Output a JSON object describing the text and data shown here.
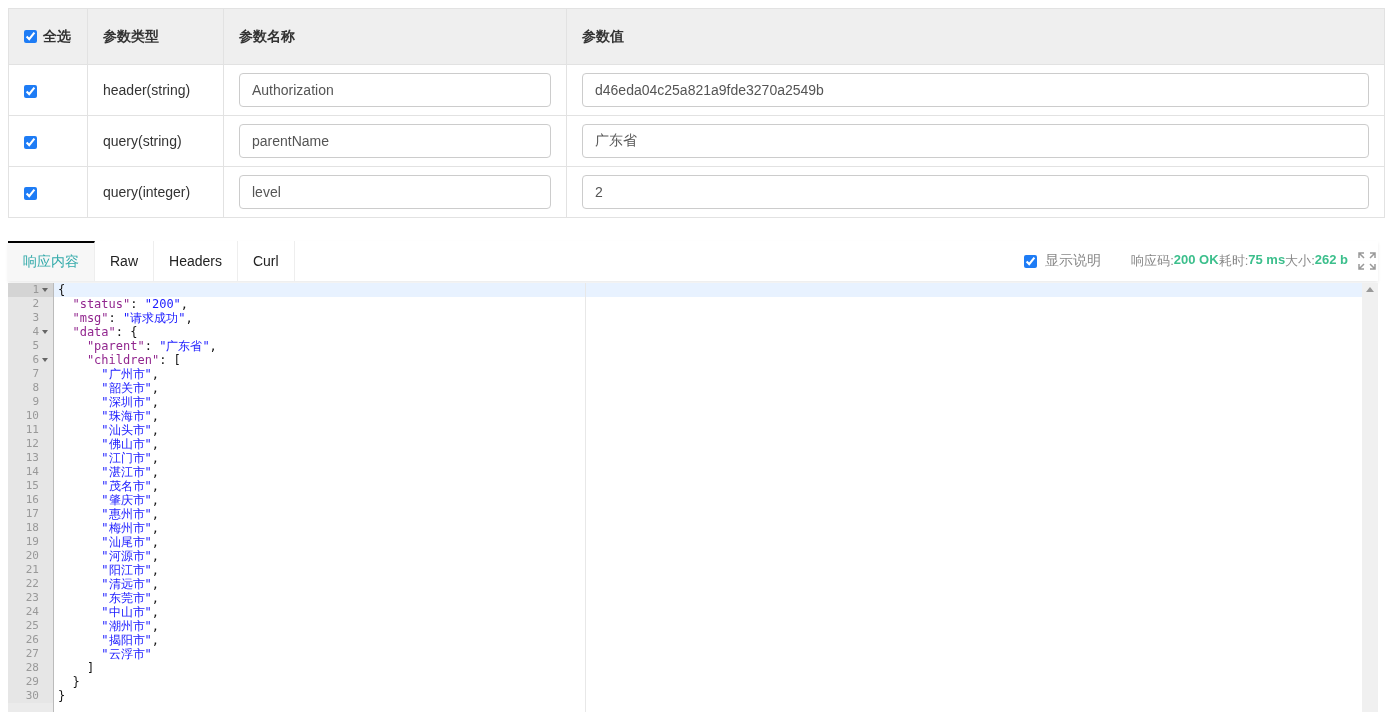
{
  "params": {
    "select_all": {
      "label": "全选",
      "checked": true
    },
    "columns": [
      "参数类型",
      "参数名称",
      "参数值"
    ],
    "rows": [
      {
        "checked": true,
        "type": "header(string)",
        "name": "Authorization",
        "value": "d46eda04c25a821a9fde3270a2549b"
      },
      {
        "checked": true,
        "type": "query(string)",
        "name": "parentName",
        "value": "广东省"
      },
      {
        "checked": true,
        "type": "query(integer)",
        "name": "level",
        "value": "2"
      }
    ]
  },
  "response": {
    "tabs": [
      {
        "label": "响应内容",
        "selected": true
      },
      {
        "label": "Raw",
        "selected": false
      },
      {
        "label": "Headers",
        "selected": false
      },
      {
        "label": "Curl",
        "selected": false
      }
    ],
    "show_notes": {
      "label": "显示说明",
      "checked": true
    },
    "stats": [
      {
        "label": "响应码:",
        "value": "200 OK"
      },
      {
        "label": "耗时:",
        "value": "75 ms"
      },
      {
        "label": "大小:",
        "value": "262 b"
      }
    ],
    "editor": {
      "lines": [
        {
          "number": "1",
          "foldable": true,
          "active": true,
          "tokens": [
            {
              "kind": "punct",
              "text": "{"
            }
          ]
        },
        {
          "number": "2",
          "foldable": false,
          "active": false,
          "tokens": [
            {
              "kind": "key",
              "text": "  \"status\""
            },
            {
              "kind": "punct",
              "text": ": "
            },
            {
              "kind": "string",
              "text": "\"200\""
            },
            {
              "kind": "punct",
              "text": ","
            }
          ]
        },
        {
          "number": "3",
          "foldable": false,
          "active": false,
          "tokens": [
            {
              "kind": "key",
              "text": "  \"msg\""
            },
            {
              "kind": "punct",
              "text": ": "
            },
            {
              "kind": "string",
              "text": "\"请求成功\""
            },
            {
              "kind": "punct",
              "text": ","
            }
          ]
        },
        {
          "number": "4",
          "foldable": true,
          "active": false,
          "tokens": [
            {
              "kind": "key",
              "text": "  \"data\""
            },
            {
              "kind": "punct",
              "text": ": {"
            }
          ]
        },
        {
          "number": "5",
          "foldable": false,
          "active": false,
          "tokens": [
            {
              "kind": "key",
              "text": "    \"parent\""
            },
            {
              "kind": "punct",
              "text": ": "
            },
            {
              "kind": "string",
              "text": "\"广东省\""
            },
            {
              "kind": "punct",
              "text": ","
            }
          ]
        },
        {
          "number": "6",
          "foldable": true,
          "active": false,
          "tokens": [
            {
              "kind": "key",
              "text": "    \"children\""
            },
            {
              "kind": "punct",
              "text": ": ["
            }
          ]
        },
        {
          "number": "7",
          "foldable": false,
          "active": false,
          "tokens": [
            {
              "kind": "string",
              "text": "      \"广州市\""
            },
            {
              "kind": "punct",
              "text": ","
            }
          ]
        },
        {
          "number": "8",
          "foldable": false,
          "active": false,
          "tokens": [
            {
              "kind": "string",
              "text": "      \"韶关市\""
            },
            {
              "kind": "punct",
              "text": ","
            }
          ]
        },
        {
          "number": "9",
          "foldable": false,
          "active": false,
          "tokens": [
            {
              "kind": "string",
              "text": "      \"深圳市\""
            },
            {
              "kind": "punct",
              "text": ","
            }
          ]
        },
        {
          "number": "10",
          "foldable": false,
          "active": false,
          "tokens": [
            {
              "kind": "string",
              "text": "      \"珠海市\""
            },
            {
              "kind": "punct",
              "text": ","
            }
          ]
        },
        {
          "number": "11",
          "foldable": false,
          "active": false,
          "tokens": [
            {
              "kind": "string",
              "text": "      \"汕头市\""
            },
            {
              "kind": "punct",
              "text": ","
            }
          ]
        },
        {
          "number": "12",
          "foldable": false,
          "active": false,
          "tokens": [
            {
              "kind": "string",
              "text": "      \"佛山市\""
            },
            {
              "kind": "punct",
              "text": ","
            }
          ]
        },
        {
          "number": "13",
          "foldable": false,
          "active": false,
          "tokens": [
            {
              "kind": "string",
              "text": "      \"江门市\""
            },
            {
              "kind": "punct",
              "text": ","
            }
          ]
        },
        {
          "number": "14",
          "foldable": false,
          "active": false,
          "tokens": [
            {
              "kind": "string",
              "text": "      \"湛江市\""
            },
            {
              "kind": "punct",
              "text": ","
            }
          ]
        },
        {
          "number": "15",
          "foldable": false,
          "active": false,
          "tokens": [
            {
              "kind": "string",
              "text": "      \"茂名市\""
            },
            {
              "kind": "punct",
              "text": ","
            }
          ]
        },
        {
          "number": "16",
          "foldable": false,
          "active": false,
          "tokens": [
            {
              "kind": "string",
              "text": "      \"肇庆市\""
            },
            {
              "kind": "punct",
              "text": ","
            }
          ]
        },
        {
          "number": "17",
          "foldable": false,
          "active": false,
          "tokens": [
            {
              "kind": "string",
              "text": "      \"惠州市\""
            },
            {
              "kind": "punct",
              "text": ","
            }
          ]
        },
        {
          "number": "18",
          "foldable": false,
          "active": false,
          "tokens": [
            {
              "kind": "string",
              "text": "      \"梅州市\""
            },
            {
              "kind": "punct",
              "text": ","
            }
          ]
        },
        {
          "number": "19",
          "foldable": false,
          "active": false,
          "tokens": [
            {
              "kind": "string",
              "text": "      \"汕尾市\""
            },
            {
              "kind": "punct",
              "text": ","
            }
          ]
        },
        {
          "number": "20",
          "foldable": false,
          "active": false,
          "tokens": [
            {
              "kind": "string",
              "text": "      \"河源市\""
            },
            {
              "kind": "punct",
              "text": ","
            }
          ]
        },
        {
          "number": "21",
          "foldable": false,
          "active": false,
          "tokens": [
            {
              "kind": "string",
              "text": "      \"阳江市\""
            },
            {
              "kind": "punct",
              "text": ","
            }
          ]
        },
        {
          "number": "22",
          "foldable": false,
          "active": false,
          "tokens": [
            {
              "kind": "string",
              "text": "      \"清远市\""
            },
            {
              "kind": "punct",
              "text": ","
            }
          ]
        },
        {
          "number": "23",
          "foldable": false,
          "active": false,
          "tokens": [
            {
              "kind": "string",
              "text": "      \"东莞市\""
            },
            {
              "kind": "punct",
              "text": ","
            }
          ]
        },
        {
          "number": "24",
          "foldable": false,
          "active": false,
          "tokens": [
            {
              "kind": "string",
              "text": "      \"中山市\""
            },
            {
              "kind": "punct",
              "text": ","
            }
          ]
        },
        {
          "number": "25",
          "foldable": false,
          "active": false,
          "tokens": [
            {
              "kind": "string",
              "text": "      \"潮州市\""
            },
            {
              "kind": "punct",
              "text": ","
            }
          ]
        },
        {
          "number": "26",
          "foldable": false,
          "active": false,
          "tokens": [
            {
              "kind": "string",
              "text": "      \"揭阳市\""
            },
            {
              "kind": "punct",
              "text": ","
            }
          ]
        },
        {
          "number": "27",
          "foldable": false,
          "active": false,
          "tokens": [
            {
              "kind": "string",
              "text": "      \"云浮市\""
            }
          ]
        },
        {
          "number": "28",
          "foldable": false,
          "active": false,
          "tokens": [
            {
              "kind": "punct",
              "text": "    ]"
            }
          ]
        },
        {
          "number": "29",
          "foldable": false,
          "active": false,
          "tokens": [
            {
              "kind": "punct",
              "text": "  }"
            }
          ]
        },
        {
          "number": "30",
          "foldable": false,
          "active": false,
          "tokens": [
            {
              "kind": "punct",
              "text": "}"
            }
          ]
        }
      ]
    }
  }
}
